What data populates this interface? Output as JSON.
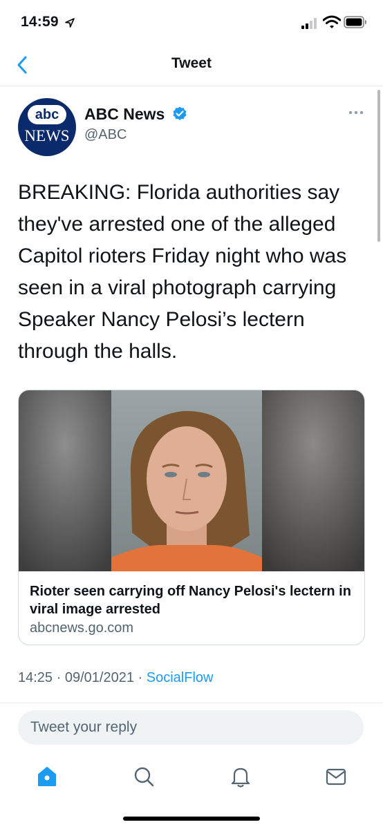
{
  "status": {
    "time": "14:59",
    "icons": [
      "location-arrow-icon",
      "signal-icon",
      "wifi-icon",
      "battery-icon"
    ]
  },
  "nav": {
    "back_icon": "chevron-left-icon",
    "title": "Tweet"
  },
  "tweet": {
    "display_name": "ABC News",
    "handle": "@ABC",
    "verified": true,
    "avatar": {
      "line1": "abc",
      "line2": "NEWS"
    },
    "text": "BREAKING: Florida authorities say they've arrested one of the alleged Capitol rioters Friday night who was seen in a viral photograph carrying Speaker Nancy Pelosi’s lectern through the halls.",
    "card": {
      "title": "Rioter seen carrying off Nancy Pelosi's lectern in viral image arrested",
      "domain": "abcnews.go.com"
    },
    "time": "14:25",
    "separator": "·",
    "date": "09/01/2021",
    "source": "SocialFlow"
  },
  "reply": {
    "placeholder": "Tweet your reply"
  },
  "tabs": [
    {
      "icon": "home-icon",
      "active": true
    },
    {
      "icon": "search-icon",
      "active": false
    },
    {
      "icon": "bell-icon",
      "active": false
    },
    {
      "icon": "mail-icon",
      "active": false
    }
  ],
  "colors": {
    "accent": "#1d9bf0",
    "text": "#0f1419",
    "secondary": "#536471",
    "border": "#cfd9de"
  }
}
